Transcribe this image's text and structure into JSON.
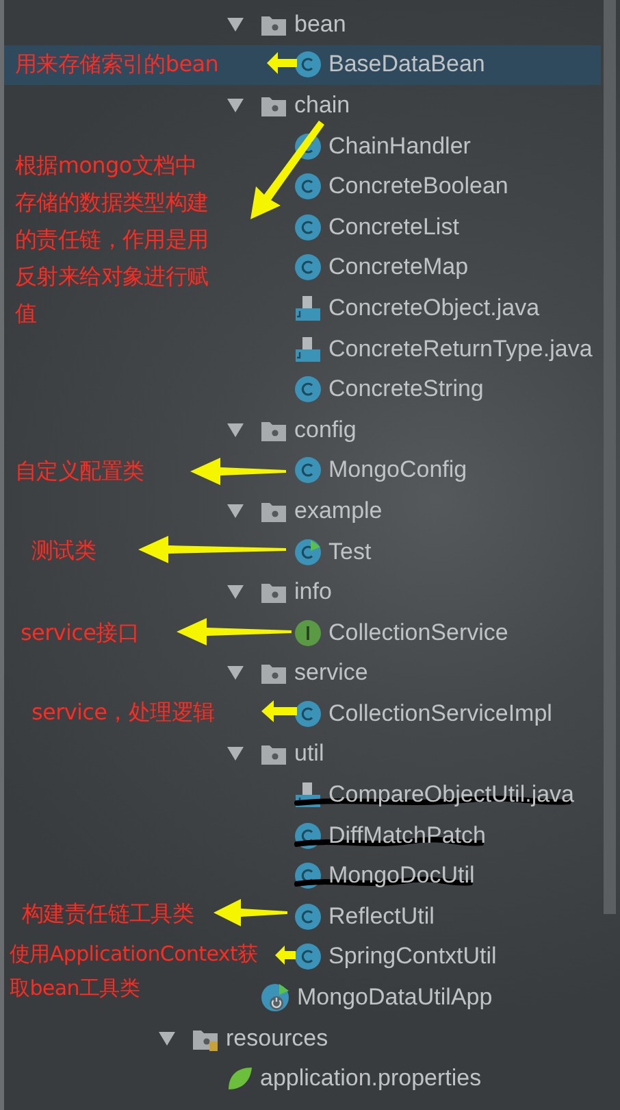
{
  "source_tree": [
    {
      "kind": "package",
      "name": "bean",
      "expanded": true,
      "selected": false,
      "children": [
        {
          "kind": "class",
          "name": "BaseDataBean",
          "selected": true,
          "scribbled": false
        }
      ]
    },
    {
      "kind": "package",
      "name": "chain",
      "expanded": true,
      "selected": false,
      "children": [
        {
          "kind": "class",
          "name": "ChainHandler",
          "selected": false,
          "scribbled": false
        },
        {
          "kind": "class",
          "name": "ConcreteBoolean",
          "selected": false,
          "scribbled": false
        },
        {
          "kind": "class",
          "name": "ConcreteList",
          "selected": false,
          "scribbled": false
        },
        {
          "kind": "class",
          "name": "ConcreteMap",
          "selected": false,
          "scribbled": false
        },
        {
          "kind": "file",
          "name": "ConcreteObject.java",
          "selected": false,
          "scribbled": false
        },
        {
          "kind": "file",
          "name": "ConcreteReturnType.java",
          "selected": false,
          "scribbled": false
        },
        {
          "kind": "class",
          "name": "ConcreteString",
          "selected": false,
          "scribbled": false
        }
      ]
    },
    {
      "kind": "package",
      "name": "config",
      "expanded": true,
      "selected": false,
      "children": [
        {
          "kind": "class",
          "name": "MongoConfig",
          "selected": false,
          "scribbled": false
        }
      ]
    },
    {
      "kind": "package",
      "name": "example",
      "expanded": true,
      "selected": false,
      "children": [
        {
          "kind": "test",
          "name": "Test",
          "selected": false,
          "scribbled": false
        }
      ]
    },
    {
      "kind": "package",
      "name": "info",
      "expanded": true,
      "selected": false,
      "children": [
        {
          "kind": "interface",
          "name": "CollectionService",
          "selected": false,
          "scribbled": false
        }
      ]
    },
    {
      "kind": "package",
      "name": "service",
      "expanded": true,
      "selected": false,
      "children": [
        {
          "kind": "class",
          "name": "CollectionServiceImpl",
          "selected": false,
          "scribbled": false
        }
      ]
    },
    {
      "kind": "package",
      "name": "util",
      "expanded": true,
      "selected": false,
      "children": [
        {
          "kind": "file",
          "name": "CompareObjectUtil.java",
          "selected": false,
          "scribbled": true
        },
        {
          "kind": "class",
          "name": "DiffMatchPatch",
          "selected": false,
          "scribbled": true
        },
        {
          "kind": "class",
          "name": "MongoDocUtil",
          "selected": false,
          "scribbled": true
        },
        {
          "kind": "class",
          "name": "ReflectUtil",
          "selected": false,
          "scribbled": false
        },
        {
          "kind": "class",
          "name": "SpringContxtUtil",
          "selected": false,
          "scribbled": false
        }
      ]
    },
    {
      "kind": "app",
      "name": "MongoDataUtilApp",
      "selected": false,
      "scribbled": false
    }
  ],
  "resources": {
    "kind": "folder",
    "name": "resources",
    "expanded": true,
    "selected": false,
    "children": [
      {
        "kind": "properties",
        "name": "application.properties",
        "selected": false,
        "scribbled": false
      }
    ]
  },
  "annotations": [
    {
      "text": "用来存储索引的bean"
    },
    {
      "text": "根据mongo文档中存储的数据类型构建的责任链，作用是用反射来给对象进行赋值"
    },
    {
      "text": "自定义配置类"
    },
    {
      "text": "测试类"
    },
    {
      "text": "service接口"
    },
    {
      "text": "service，处理逻辑"
    },
    {
      "text": "构建责任链工具类"
    },
    {
      "text": "使用ApplicationContext获取bean工具类"
    }
  ]
}
